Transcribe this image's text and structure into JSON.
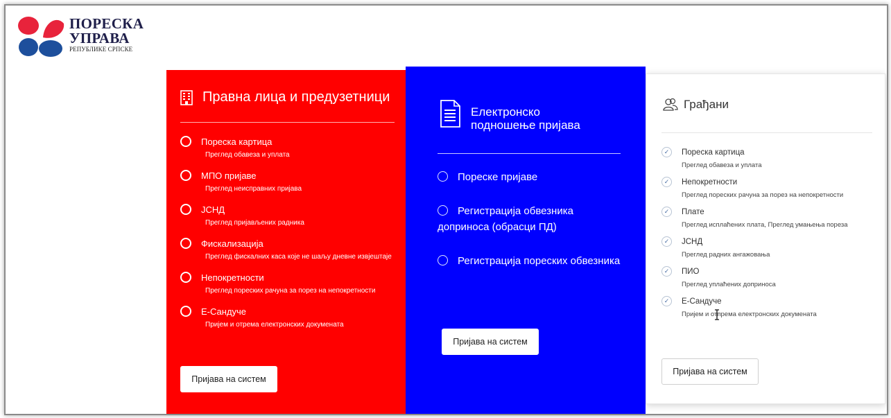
{
  "logo": {
    "line1": "ПОРЕСКА",
    "line2": "УПРАВА",
    "line3": "РЕПУБЛИКЕ СРПСКЕ",
    "colors": {
      "red": "#e8233b",
      "blue": "#1d4f9c"
    }
  },
  "legal_entities": {
    "icon": "building-icon",
    "title": "Правна лица и предузетници",
    "items": [
      {
        "label": "Пореска картица",
        "sub": "Преглед обавеза и уплата"
      },
      {
        "label": "МПО пријаве",
        "sub": "Преглед неисправних пријава"
      },
      {
        "label": "ЈСНД",
        "sub": "Преглед пријављених радника"
      },
      {
        "label": "Фискализација",
        "sub": "Преглед фискалних каса које не шаљу дневне извјештаје"
      },
      {
        "label": "Непокретности",
        "sub": "Преглед пореских рачуна за порез на непокретности"
      },
      {
        "label": "Е-Сандуче",
        "sub": "Пријем и отрема електронских докумената"
      }
    ],
    "login_label": "Пријава на систем",
    "background": "#ff0000"
  },
  "electronic": {
    "icon": "document-icon",
    "title_line1": "Електронско",
    "title_line2": "подношење пријава",
    "items": [
      {
        "label": "Пореске пријаве"
      },
      {
        "label": "Регистрација обвезника доприноса (обрасци ПД)"
      },
      {
        "label": "Регистрација пореских обвезника"
      }
    ],
    "login_label": "Пријава на систем",
    "background": "#0000ff"
  },
  "citizens": {
    "icon": "users-icon",
    "title": "Грађани",
    "items": [
      {
        "label": "Пореска картица",
        "sub": "Преглед обавеза и уплата"
      },
      {
        "label": "Непокретности",
        "sub": "Преглед пореских рачуна за порез на непокретности"
      },
      {
        "label": "Плате",
        "sub": "Преглед исплаћених плата, Преглед умањења пореза"
      },
      {
        "label": "ЈСНД",
        "sub": "Преглед радних ангажовања"
      },
      {
        "label": "ПИО",
        "sub": "Преглед уплаћених доприноса"
      },
      {
        "label": "Е-Сандуче",
        "sub": "Пријем и отпрема електронских докумената"
      }
    ],
    "login_label": "Пријава на систем"
  }
}
